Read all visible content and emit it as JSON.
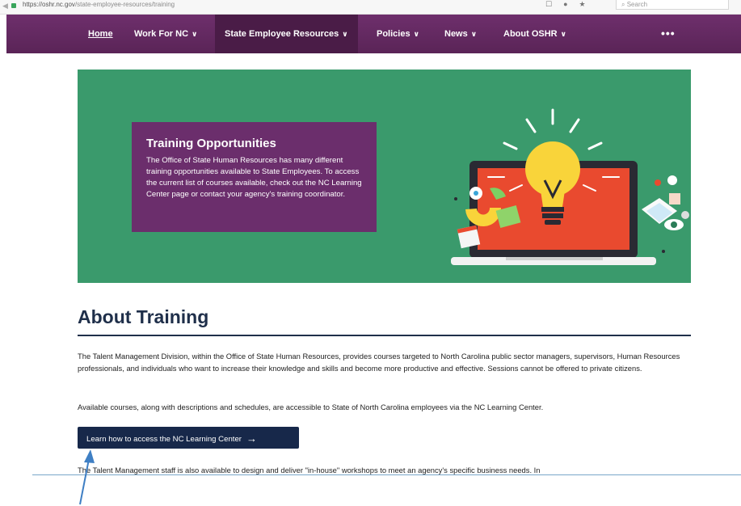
{
  "browser": {
    "url_prefix": "https://oshr.nc.gov",
    "url_path": "/state-employee-resources/training",
    "search_placeholder": "Search"
  },
  "nav": {
    "items": [
      {
        "label": "Home",
        "has_dropdown": false
      },
      {
        "label": "Work For NC",
        "has_dropdown": true
      },
      {
        "label": "State Employee Resources",
        "has_dropdown": true,
        "active": true
      },
      {
        "label": "Policies",
        "has_dropdown": true
      },
      {
        "label": "News",
        "has_dropdown": true
      },
      {
        "label": "About OSHR",
        "has_dropdown": true
      }
    ],
    "more_label": "•••",
    "chevron": "⌄"
  },
  "hero": {
    "title": "Training Opportunities",
    "body": "The Office of State Human Resources has many different training opportunities available to State Employees. To access the current list of courses available, check out the NC Learning Center page or contact your agency's training coordinator.",
    "background_color": "#3a9a6c",
    "card_color": "#6b2e6c"
  },
  "about": {
    "title": "About Training",
    "paragraph1": "The Talent Management Division, within the Office of State Human Resources, provides courses targeted to North Carolina public sector managers, supervisors, Human Resources professionals, and individuals who want to increase their knowledge and skills and become more productive and effective. Sessions cannot be offered to private citizens.",
    "paragraph2": "Available courses, along with descriptions and schedules, are accessible to State of North Carolina employees via the NC Learning Center.",
    "cta_label": "Learn how to access the NC Learning Center",
    "cta_arrow": "→",
    "paragraph3": "The Talent Management staff is also available to design and deliver \"in-house\" workshops to meet an agency's specific business needs. In"
  },
  "colors": {
    "nav": "#6e2f6c",
    "nav_active": "#4a1c47",
    "heading": "#1f2f4a",
    "button": "#17284a",
    "annotation_arrow": "#3f7fc4"
  }
}
